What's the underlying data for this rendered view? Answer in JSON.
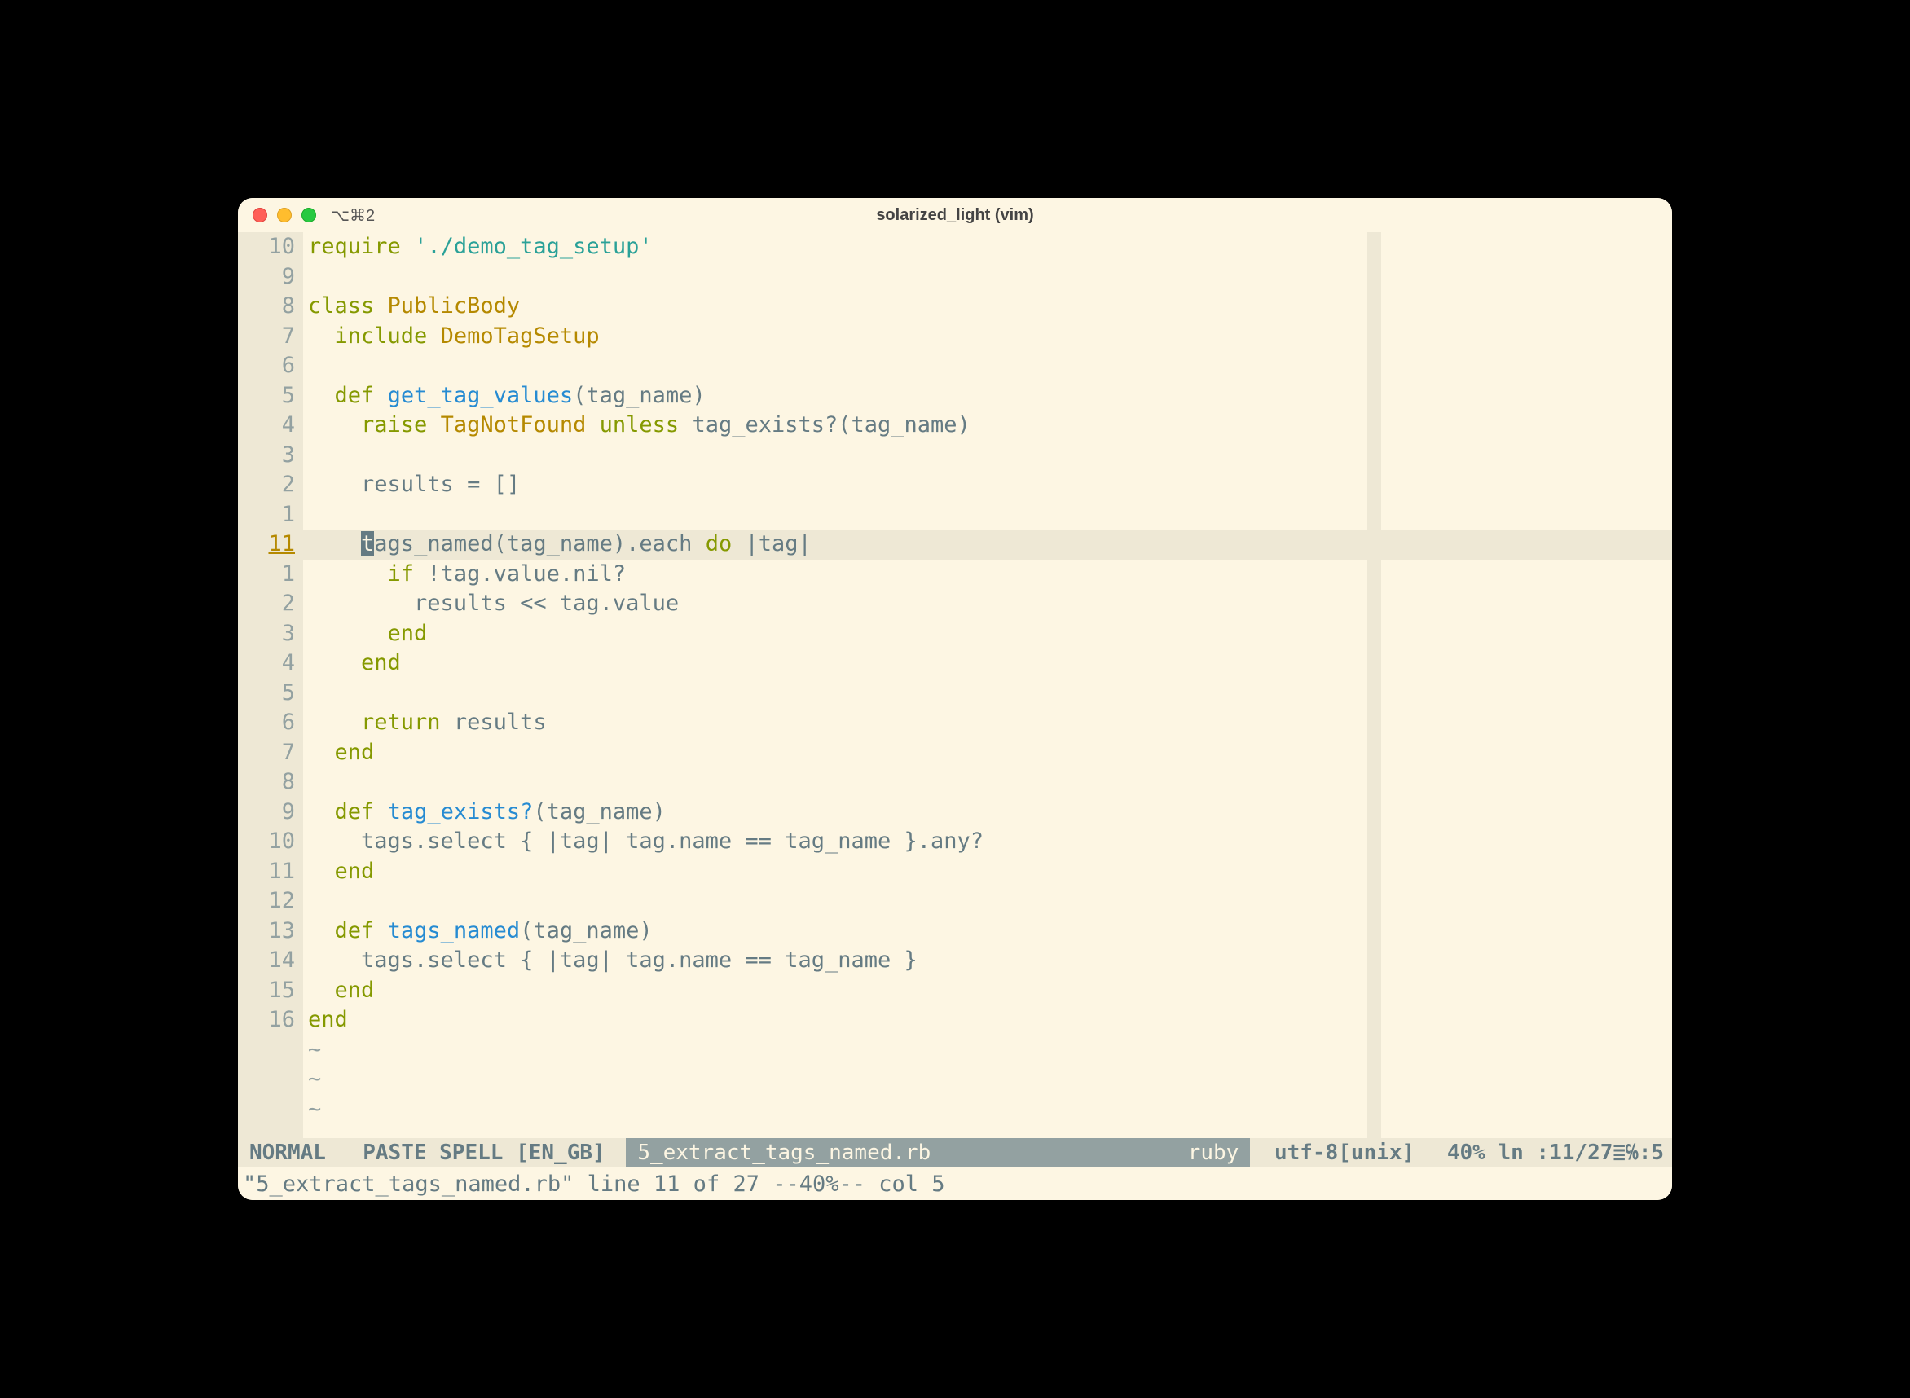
{
  "window": {
    "tab_indicator": "⌥⌘2",
    "title": "solarized_light (vim)"
  },
  "gutter": {
    "lines": [
      "10",
      "9",
      "8",
      "7",
      "6",
      "5",
      "4",
      "3",
      "2",
      "1",
      "11",
      "1",
      "2",
      "3",
      "4",
      "5",
      "6",
      "7",
      "8",
      "9",
      "10",
      "11",
      "12",
      "13",
      "14",
      "15",
      "16"
    ],
    "current_index": 10
  },
  "code": {
    "lines": [
      [
        {
          "t": "require",
          "c": "kw-req"
        },
        {
          "t": " "
        },
        {
          "t": "'./demo_tag_setup'",
          "c": "str"
        }
      ],
      [],
      [
        {
          "t": "class",
          "c": "kw-cls"
        },
        {
          "t": " "
        },
        {
          "t": "PublicBody",
          "c": "type"
        }
      ],
      [
        {
          "t": "  "
        },
        {
          "t": "include",
          "c": "kw-req"
        },
        {
          "t": " "
        },
        {
          "t": "DemoTagSetup",
          "c": "type"
        }
      ],
      [],
      [
        {
          "t": "  "
        },
        {
          "t": "def",
          "c": "kw-def"
        },
        {
          "t": " "
        },
        {
          "t": "get_tag_values",
          "c": "func"
        },
        {
          "t": "(tag_name)"
        }
      ],
      [
        {
          "t": "    "
        },
        {
          "t": "raise",
          "c": "kw-req"
        },
        {
          "t": " "
        },
        {
          "t": "TagNotFound",
          "c": "type"
        },
        {
          "t": " "
        },
        {
          "t": "unless",
          "c": "kw-req"
        },
        {
          "t": " tag_exists?(tag_name)"
        }
      ],
      [],
      [
        {
          "t": "    results = []"
        }
      ],
      [],
      [
        {
          "t": "    "
        },
        {
          "t": "t",
          "c": "cursor"
        },
        {
          "t": "ags_named(tag_name).each "
        },
        {
          "t": "do",
          "c": "kw-do"
        },
        {
          "t": " |tag|"
        }
      ],
      [
        {
          "t": "      "
        },
        {
          "t": "if",
          "c": "kw-if"
        },
        {
          "t": " !tag.value.nil?"
        }
      ],
      [
        {
          "t": "        results << tag.value"
        }
      ],
      [
        {
          "t": "      "
        },
        {
          "t": "end",
          "c": "kw-end"
        }
      ],
      [
        {
          "t": "    "
        },
        {
          "t": "end",
          "c": "kw-end"
        }
      ],
      [],
      [
        {
          "t": "    "
        },
        {
          "t": "return",
          "c": "kw-req"
        },
        {
          "t": " results"
        }
      ],
      [
        {
          "t": "  "
        },
        {
          "t": "end",
          "c": "kw-end"
        }
      ],
      [],
      [
        {
          "t": "  "
        },
        {
          "t": "def",
          "c": "kw-def"
        },
        {
          "t": " "
        },
        {
          "t": "tag_exists?",
          "c": "func"
        },
        {
          "t": "(tag_name)"
        }
      ],
      [
        {
          "t": "    tags.select { |tag| tag.name == tag_name }.any?"
        }
      ],
      [
        {
          "t": "  "
        },
        {
          "t": "end",
          "c": "kw-end"
        }
      ],
      [],
      [
        {
          "t": "  "
        },
        {
          "t": "def",
          "c": "kw-def"
        },
        {
          "t": " "
        },
        {
          "t": "tags_named",
          "c": "func"
        },
        {
          "t": "(tag_name)"
        }
      ],
      [
        {
          "t": "    tags.select { |tag| tag.name == tag_name }"
        }
      ],
      [
        {
          "t": "  "
        },
        {
          "t": "end",
          "c": "kw-end"
        }
      ],
      [
        {
          "t": "end",
          "c": "kw-end"
        }
      ]
    ],
    "tilde_count": 3,
    "tilde_char": "~"
  },
  "statusline": {
    "mode": "NORMAL",
    "flags": "PASTE  SPELL [EN_GB]",
    "filename": "5_extract_tags_named.rb",
    "filetype": "ruby",
    "encoding": "utf-8[unix]",
    "percent": "40%",
    "position_prefix": "ln :",
    "line": "11",
    "total": "27",
    "col_prefix": ":",
    "col": "5",
    "ln_sep": "≣",
    "col_sep": "℅"
  },
  "cmdline": "\"5_extract_tags_named.rb\" line 11 of 27 --40%-- col 5"
}
